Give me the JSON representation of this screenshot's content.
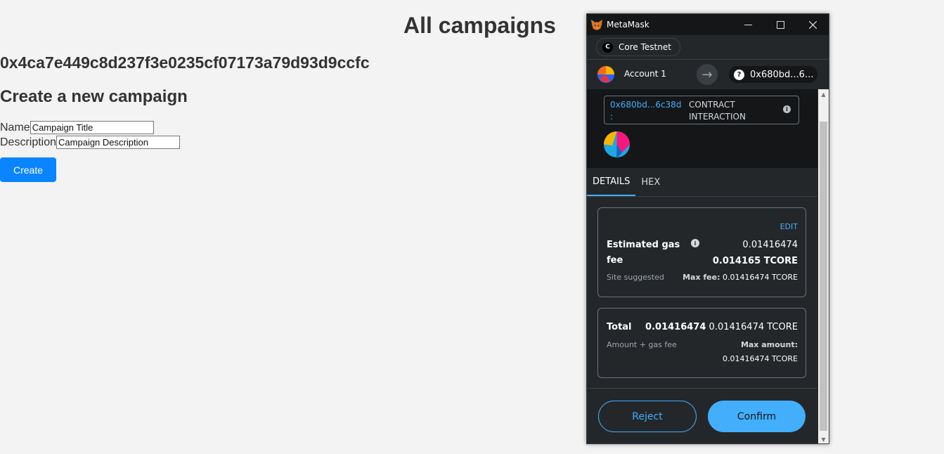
{
  "page": {
    "title": "All campaigns",
    "address": "0x4ca7e449c8d237f3e0235cf07173a79d93d9ccfc",
    "create_heading": "Create a new campaign",
    "name_label": "Name",
    "name_value": "Campaign Title",
    "description_label": "Description",
    "description_value": "Campaign Description",
    "create_button": "Create"
  },
  "metamask": {
    "window_title": "MetaMask",
    "network": {
      "icon_letter": "C",
      "name": "Core Testnet"
    },
    "account": {
      "name": "Account 1"
    },
    "recipient": {
      "icon": "?",
      "address": "0x680bd...6..."
    },
    "contract": {
      "address": "0x680bd...6c38d",
      "colon": ":",
      "type_line1": "CONTRACT",
      "type_line2": "INTERACTION"
    },
    "tabs": [
      {
        "label": "DETAILS",
        "active": true
      },
      {
        "label": "HEX",
        "active": false
      }
    ],
    "gas": {
      "edit_label": "EDIT",
      "label": "Estimated gas fee",
      "fiat_value": "0.01416474",
      "native_value": "0.014165 TCORE",
      "site_suggested": "Site suggested",
      "max_fee_label": "Max fee:",
      "max_fee_value": "0.01416474 TCORE"
    },
    "total": {
      "label": "Total",
      "value_bold": "0.01416474",
      "value_rest": "0.01416474 TCORE",
      "amount_gas": "Amount + gas fee",
      "max_amount_label": "Max amount:",
      "max_amount_value": "0.01416474 TCORE"
    },
    "buttons": {
      "reject": "Reject",
      "confirm": "Confirm"
    },
    "icons": [
      "fox-icon",
      "minimize-icon",
      "maximize-icon",
      "close-icon",
      "arrow-right-icon",
      "info-icon",
      "question-icon"
    ],
    "colors": {
      "accent": "#43aefc",
      "panel": "#24272a",
      "dark": "#141618"
    }
  }
}
